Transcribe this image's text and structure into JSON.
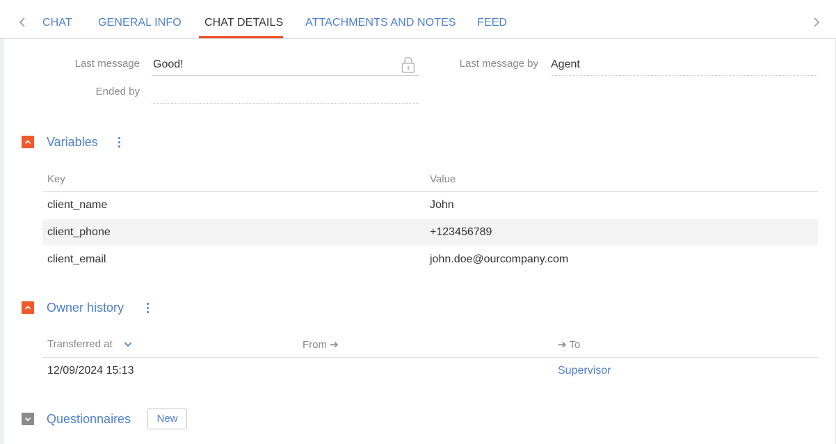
{
  "tabs": {
    "items": [
      "CHAT",
      "GENERAL INFO",
      "CHAT DETAILS",
      "ATTACHMENTS AND NOTES",
      "FEED"
    ],
    "active": "CHAT DETAILS",
    "prev_icon": "chevron-left-icon",
    "next_icon": "chevron-right-icon"
  },
  "fields": {
    "last_message": {
      "label": "Last message",
      "value": "Good!",
      "locked": true
    },
    "ended_by": {
      "label": "Ended by",
      "value": ""
    },
    "last_message_by": {
      "label": "Last message by",
      "value": "Agent"
    }
  },
  "variables": {
    "title": "Variables",
    "expanded": true,
    "columns": [
      "Key",
      "Value"
    ],
    "rows": [
      {
        "key": "client_name",
        "value": "John"
      },
      {
        "key": "client_phone",
        "value": "+123456789"
      },
      {
        "key": "client_email",
        "value": "john.doe@ourcompany.com"
      }
    ]
  },
  "owner_history": {
    "title": "Owner history",
    "expanded": true,
    "columns": [
      "Transferred at",
      "From ➔",
      "➔ To"
    ],
    "sort_icon": "chevron-down-icon",
    "rows": [
      {
        "transferred_at": "12/09/2024 15:13",
        "from": "",
        "to": "Supervisor"
      }
    ]
  },
  "questionnaires": {
    "title": "Questionnaires",
    "expanded": false,
    "new_button": "New"
  },
  "colors": {
    "accent": "#f05a28",
    "link": "#4d7fcf",
    "collapsed_toggle": "#8a8a8a"
  }
}
